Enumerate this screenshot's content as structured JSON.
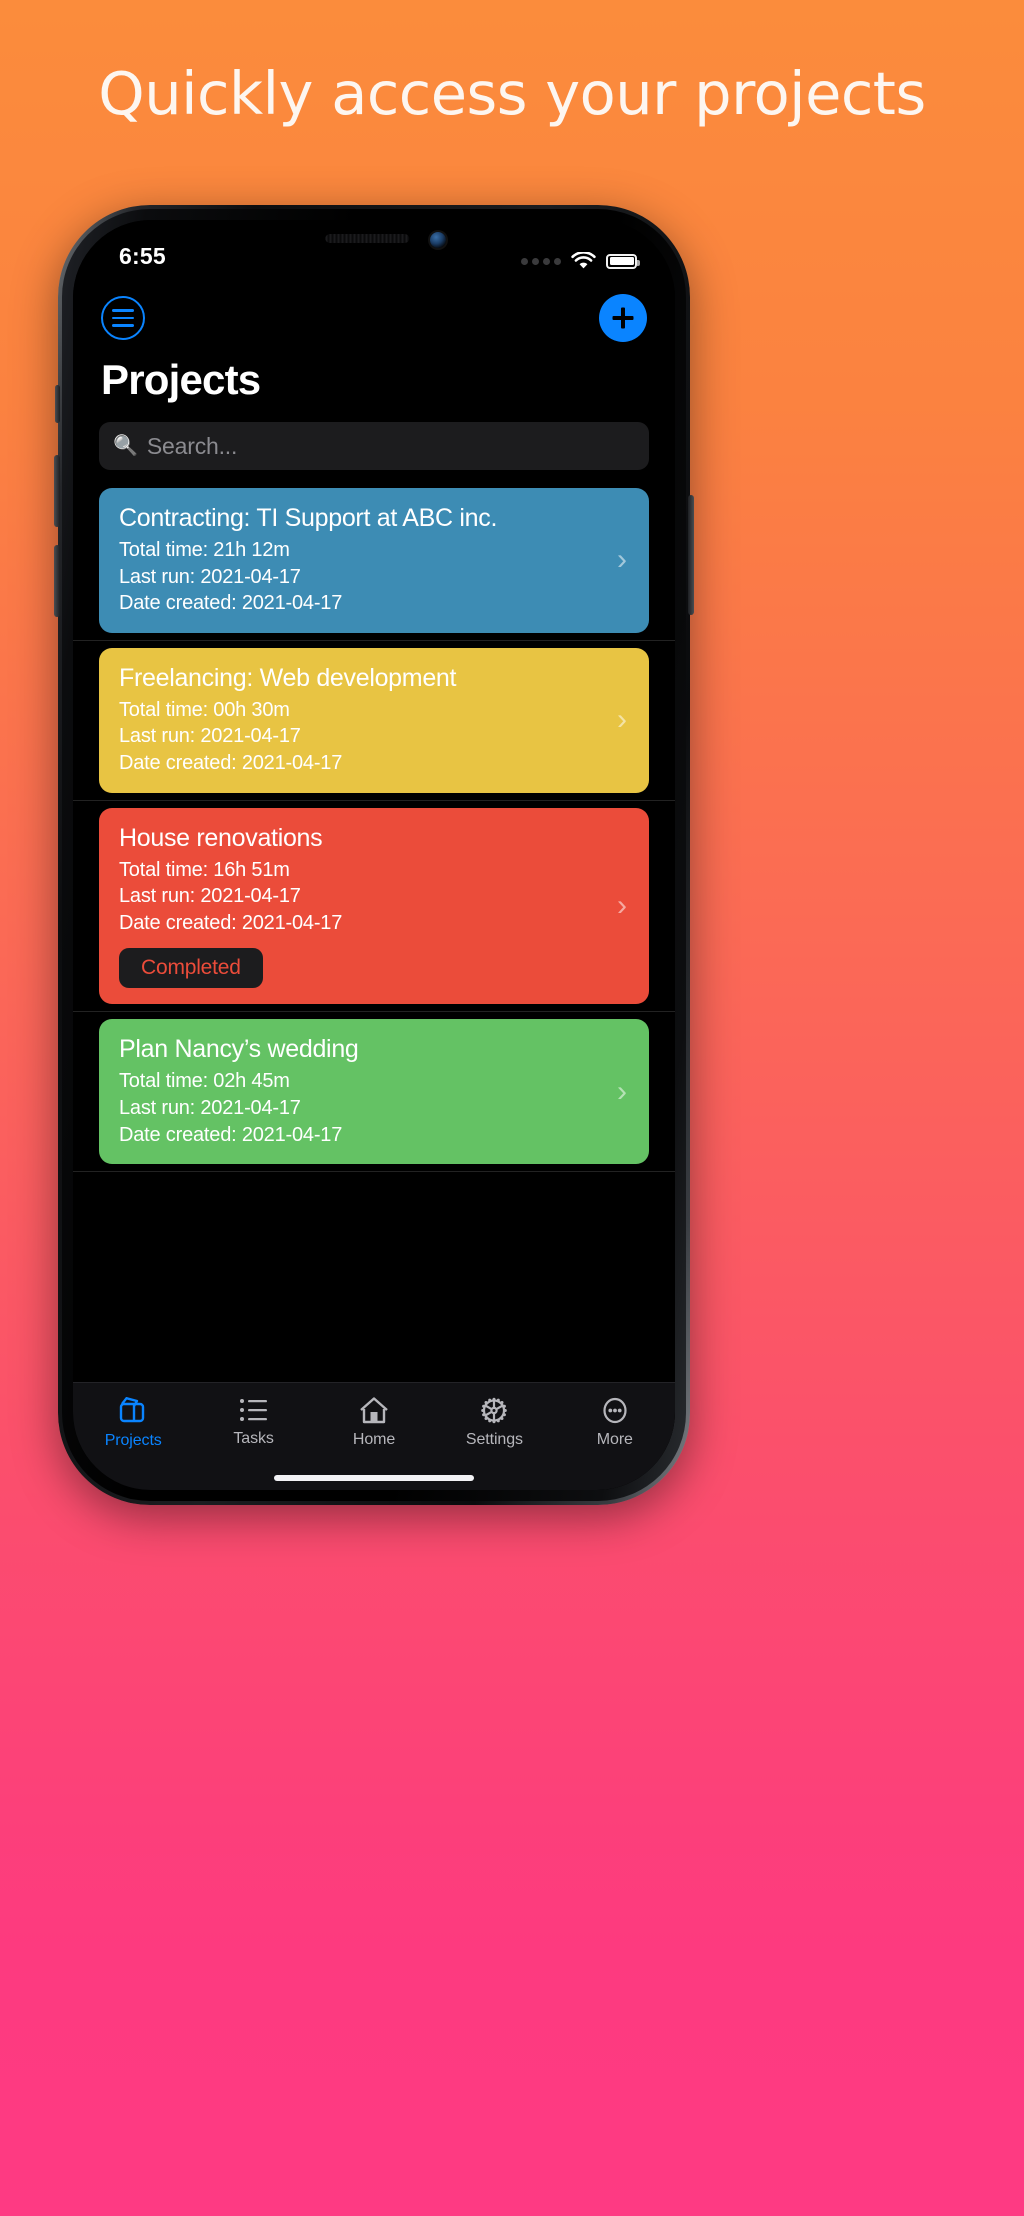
{
  "headline": "Quickly access your projects",
  "status_bar": {
    "time": "6:55",
    "signal_icon": "signal-dots-icon",
    "wifi_icon": "wifi-icon",
    "battery_icon": "battery-full-icon"
  },
  "nav": {
    "menu_icon": "hamburger-menu-icon",
    "add_icon": "plus-icon",
    "title": "Projects"
  },
  "search": {
    "icon": "search-icon",
    "placeholder": "Search...",
    "value": ""
  },
  "labels": {
    "total_time": "Total time:",
    "last_run": "Last run:",
    "date_created": "Date created:",
    "chevron": "›"
  },
  "projects": [
    {
      "title": "Contracting: TI Support at ABC inc.",
      "total_time": "Total time: 21h 12m",
      "last_run": "Last run: 2021-04-17",
      "date_created": "Date created: 2021-04-17",
      "color": "#3d8cb4",
      "badge": null
    },
    {
      "title": "Freelancing: Web development",
      "total_time": "Total time: 00h 30m",
      "last_run": "Last run: 2021-04-17",
      "date_created": "Date created: 2021-04-17",
      "color": "#e8c443",
      "badge": null
    },
    {
      "title": "House renovations",
      "total_time": "Total time: 16h 51m",
      "last_run": "Last run: 2021-04-17",
      "date_created": "Date created: 2021-04-17",
      "color": "#eb4c3a",
      "badge": "Completed",
      "badge_color": "#eb4c3a"
    },
    {
      "title": "Plan Nancy’s wedding",
      "total_time": "Total time: 02h 45m",
      "last_run": "Last run: 2021-04-17",
      "date_created": "Date created: 2021-04-17",
      "color": "#64c264",
      "badge": null
    }
  ],
  "tabs": [
    {
      "label": "Projects",
      "icon": "folders-icon",
      "active": true
    },
    {
      "label": "Tasks",
      "icon": "list-icon",
      "active": false
    },
    {
      "label": "Home",
      "icon": "house-icon",
      "active": false
    },
    {
      "label": "Settings",
      "icon": "gear-icon",
      "active": false
    },
    {
      "label": "More",
      "icon": "ellipsis-circle-icon",
      "active": false
    }
  ],
  "colors": {
    "accent": "#0a84ff",
    "screen_bg": "#000000",
    "card_blue": "#3d8cb4",
    "card_yellow": "#e8c443",
    "card_red": "#eb4c3a",
    "card_green": "#64c264",
    "gradient_top": "#fb8c3c",
    "gradient_bottom": "#fe3a83"
  }
}
